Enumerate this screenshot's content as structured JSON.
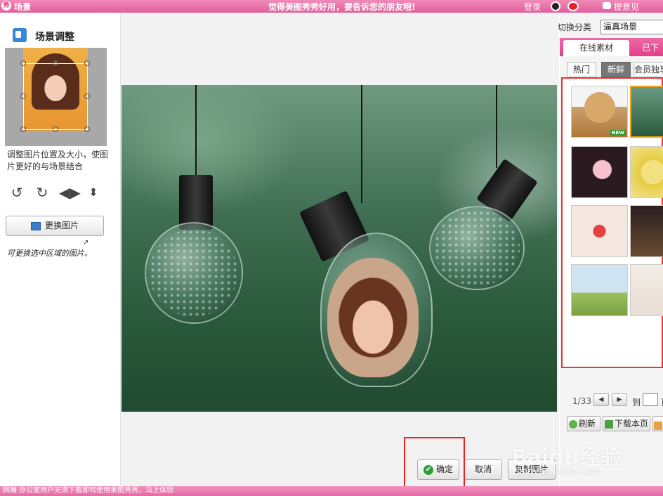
{
  "titlebar": {
    "app_logo": "秀",
    "title": "场景",
    "slogan": "觉得美图秀秀好用，要告诉您的朋友哦!",
    "login": "登录",
    "feedback": "提意见"
  },
  "left_panel": {
    "header": "场景调整",
    "hint": "调整图片位置及大小，使图片更好的与场景结合",
    "replace_button": "更换图片",
    "handwritten_note": "可更换选中区域的图片。",
    "tools": [
      "rotate-left-icon",
      "rotate-right-icon",
      "flip-horizontal-icon",
      "flip-vertical-icon"
    ]
  },
  "actions": {
    "confirm": "确定",
    "cancel": "取消",
    "copy_image": "复制图片"
  },
  "right_panel": {
    "category_label": "切换分类",
    "category_value": "逼真场景",
    "tabs": [
      "在线素材",
      "已下"
    ],
    "subtabs": [
      "热门",
      "新鲜",
      "会员独享"
    ],
    "active_subtab": "新鲜",
    "new_badge": "NEW",
    "pager": "1/33",
    "pager_to": "到",
    "pager_page": "页",
    "refresh": "刷新",
    "download_page": "下载本页"
  },
  "statusbar": {
    "text": "网赚 办公室用户无须下载即可使用美图秀秀，马上体验"
  },
  "watermark": {
    "logo": "Baidu经验",
    "url": "jingyan.baidu.com"
  },
  "colors": {
    "titlebar": "#e25d9b",
    "highlight_box": "#e22222",
    "selected_thumb": "#f2a21a"
  }
}
